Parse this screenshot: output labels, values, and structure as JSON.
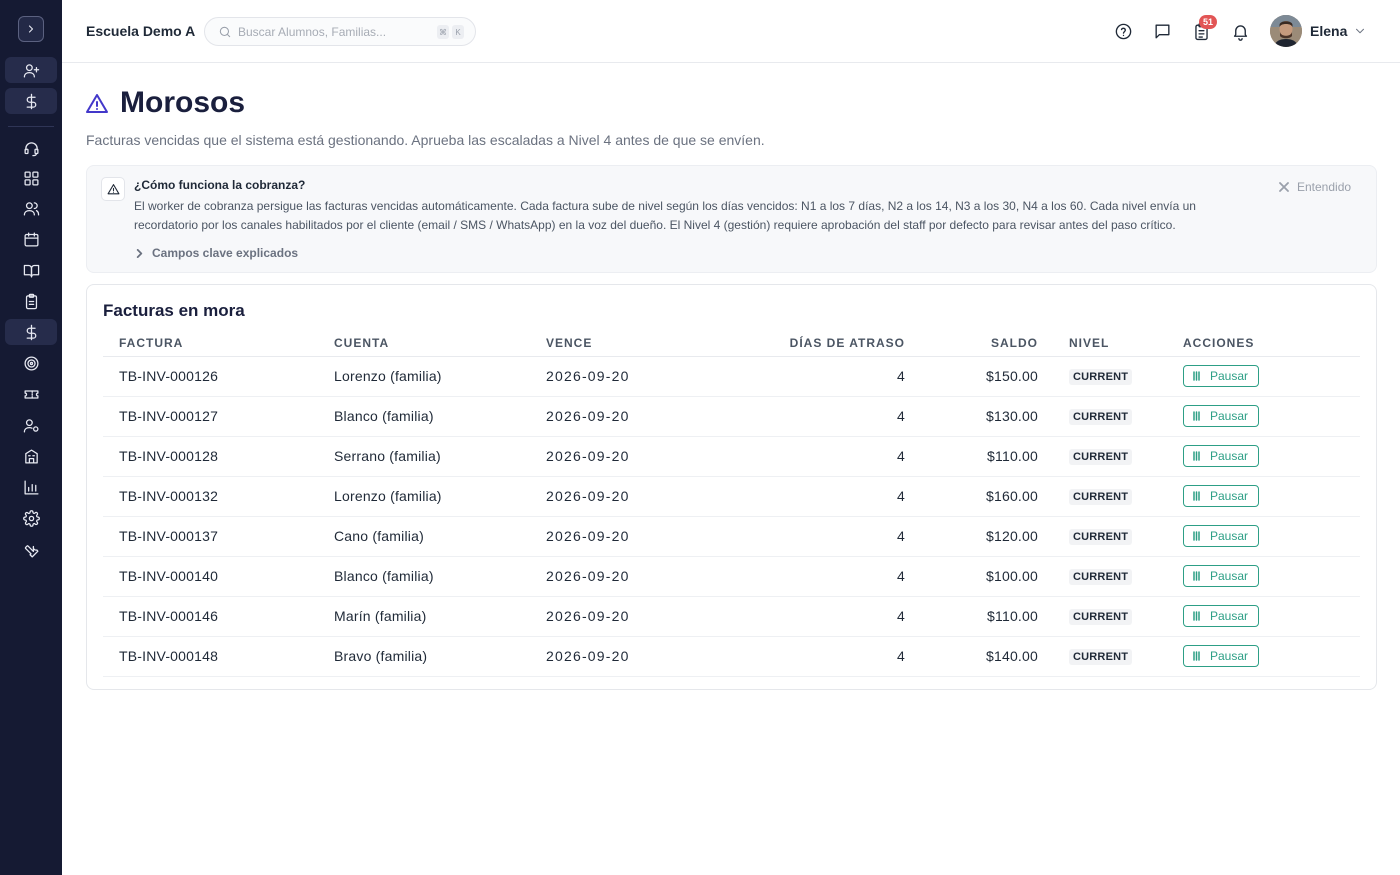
{
  "header": {
    "school_name": "Escuela Demo A",
    "search_placeholder": "Buscar Alumnos, Familias...",
    "shortcut_keys": [
      "⌘",
      "K"
    ],
    "notifications_count": "51",
    "user_name": "Elena"
  },
  "page": {
    "title": "Morosos",
    "subtitle": "Facturas vencidas que el sistema está gestionando. Aprueba las escaladas a Nivel 4 antes de que se envíen."
  },
  "info_box": {
    "title": "¿Cómo funciona la cobranza?",
    "body": "El worker de cobranza persigue las facturas vencidas automáticamente. Cada factura sube de nivel según los días vencidos: N1 a los 7 días, N2 a los 14, N3 a los 30, N4 a los 60. Cada nivel envía un recordatorio por los canales habilitados por el cliente (email / SMS / WhatsApp) en la voz del dueño. El Nivel 4 (gestión) requiere aprobación del staff por defecto para revisar antes del paso crítico.",
    "dismiss_label": "Entendido",
    "expand_label": "Campos clave explicados"
  },
  "table": {
    "title": "Facturas en mora",
    "columns": [
      "FACTURA",
      "CUENTA",
      "VENCE",
      "DÍAS DE ATRASO",
      "SALDO",
      "NIVEL",
      "ACCIONES"
    ],
    "action_label": "Pausar",
    "rows": [
      {
        "invoice": "TB-INV-000126",
        "account": "Lorenzo (familia)",
        "due": "2026-09-20",
        "days_overdue": "4",
        "balance": "$150.00",
        "level": "CURRENT"
      },
      {
        "invoice": "TB-INV-000127",
        "account": "Blanco (familia)",
        "due": "2026-09-20",
        "days_overdue": "4",
        "balance": "$130.00",
        "level": "CURRENT"
      },
      {
        "invoice": "TB-INV-000128",
        "account": "Serrano (familia)",
        "due": "2026-09-20",
        "days_overdue": "4",
        "balance": "$110.00",
        "level": "CURRENT"
      },
      {
        "invoice": "TB-INV-000132",
        "account": "Lorenzo (familia)",
        "due": "2026-09-20",
        "days_overdue": "4",
        "balance": "$160.00",
        "level": "CURRENT"
      },
      {
        "invoice": "TB-INV-000137",
        "account": "Cano (familia)",
        "due": "2026-09-20",
        "days_overdue": "4",
        "balance": "$120.00",
        "level": "CURRENT"
      },
      {
        "invoice": "TB-INV-000140",
        "account": "Blanco (familia)",
        "due": "2026-09-20",
        "days_overdue": "4",
        "balance": "$100.00",
        "level": "CURRENT"
      },
      {
        "invoice": "TB-INV-000146",
        "account": "Marín (familia)",
        "due": "2026-09-20",
        "days_overdue": "4",
        "balance": "$110.00",
        "level": "CURRENT"
      },
      {
        "invoice": "TB-INV-000148",
        "account": "Bravo (familia)",
        "due": "2026-09-20",
        "days_overdue": "4",
        "balance": "$140.00",
        "level": "CURRENT"
      }
    ]
  },
  "sidebar": {
    "icons": [
      "expand-sidebar-icon",
      "add-user-icon",
      "dollar-icon",
      "headset-icon",
      "dashboard-icon",
      "users-icon",
      "calendar-icon",
      "book-icon",
      "clipboard-icon",
      "billing-icon",
      "target-icon",
      "ticket-icon",
      "user-settings-icon",
      "building-icon",
      "chart-icon",
      "settings-icon",
      "wrench-icon"
    ]
  },
  "colors": {
    "sidebar_bg": "#151a33",
    "accent": "#4338ca",
    "action_green": "#2d9f86",
    "badge_red": "#e25555"
  }
}
